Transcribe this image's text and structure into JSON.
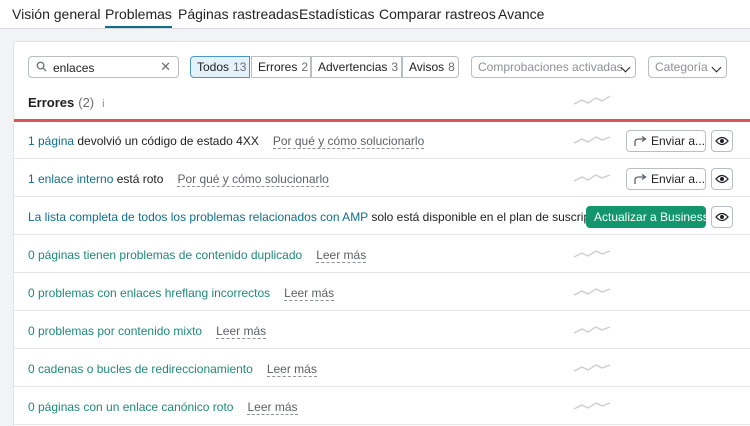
{
  "tabs": [
    "Visión general",
    "Problemas",
    "Páginas rastreadas",
    "Estadísticas",
    "Comparar rastreos",
    "Avance"
  ],
  "search": {
    "value": "enlaces"
  },
  "filters": [
    {
      "label": "Todos",
      "count": "13"
    },
    {
      "label": "Errores",
      "count": "2"
    },
    {
      "label": "Advertencias",
      "count": "3"
    },
    {
      "label": "Avisos",
      "count": "8"
    }
  ],
  "checks_dropdown": "Comprobaciones activadas",
  "category_dropdown": "Categoría",
  "section": {
    "title": "Errores",
    "count": "(2)",
    "info": "i"
  },
  "rows": [
    {
      "link": "1 página",
      "text": " devolvió un código de estado 4XX",
      "why": "Por qué y cómo solucionarlo",
      "action": "Enviar a..."
    },
    {
      "link": "1 enlace interno",
      "text": " está roto",
      "why": "Por qué y cómo solucionarlo",
      "action": "Enviar a..."
    },
    {
      "link": "La lista completa de todos los problemas relacionados con AMP",
      "text": " solo está disponible en el plan de suscripci...",
      "action": "Actualizar a Business"
    },
    {
      "muted": "0 páginas tienen problemas de contenido duplicado",
      "why": "Leer más"
    },
    {
      "muted": "0 problemas con enlaces hreflang incorrectos",
      "why": "Leer más"
    },
    {
      "muted": "0 problemas por contenido mixto",
      "why": "Leer más"
    },
    {
      "muted": "0 cadenas o bucles de redireccionamiento",
      "why": "Leer más"
    },
    {
      "muted": "0 páginas con un enlace canónico roto",
      "why": "Leer más"
    }
  ],
  "colors": {
    "accent": "#0f6f8a",
    "error_line": "#e0535a",
    "business_button": "#13966c"
  }
}
